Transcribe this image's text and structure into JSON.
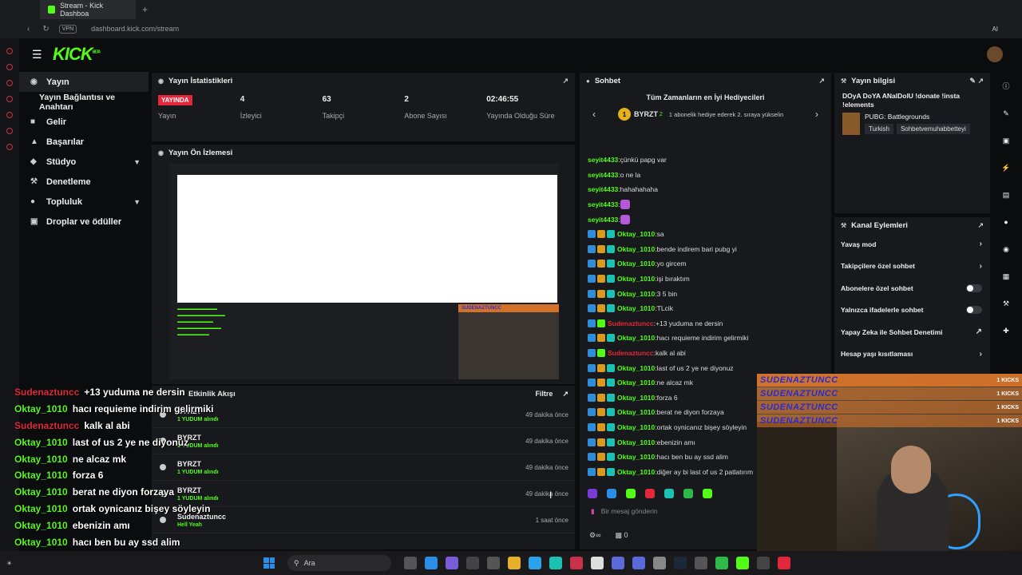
{
  "browser": {
    "tab_title": "Stream - Kick Dashboa",
    "url": "dashboard.kick.com/stream",
    "vpn": "VPN",
    "ai": "AI"
  },
  "app": {
    "logo": "KICK",
    "logo_beta": "BETA"
  },
  "nav": {
    "items": [
      {
        "label": "Yayın",
        "icon": "broadcast-icon"
      },
      {
        "label": "Yayın Bağlantısı ve Anahtarı",
        "icon": ""
      },
      {
        "label": "Gelir",
        "icon": "money-icon"
      },
      {
        "label": "Başarılar",
        "icon": "trophy-icon"
      },
      {
        "label": "Stüdyo",
        "icon": "studio-icon"
      },
      {
        "label": "Denetleme",
        "icon": "wrench-icon"
      },
      {
        "label": "Topluluk",
        "icon": "community-icon"
      },
      {
        "label": "Droplar ve ödüller",
        "icon": "gift-icon"
      }
    ]
  },
  "stats": {
    "title": "Yayın İstatistikleri",
    "items": [
      {
        "value": "YAYINDA",
        "label": "Yayın"
      },
      {
        "value": "4",
        "label": "İzleyici"
      },
      {
        "value": "63",
        "label": "Takipçi"
      },
      {
        "value": "2",
        "label": "Abone Sayısı"
      },
      {
        "value": "02:46:55",
        "label": "Yayında Olduğu Süre"
      }
    ]
  },
  "preview": {
    "title": "Yayın Ön İzlemesi",
    "cam_label": "SUDENAZTUNCC"
  },
  "activity": {
    "title": "Etkinlik Akışı",
    "filter": "Filtre",
    "rows": [
      {
        "user": "BYRZT",
        "action": "1 YUDUM alındı",
        "time": "49 dakika önce"
      },
      {
        "user": "BYRZT",
        "action": "1 YUDUM alındı",
        "time": "49 dakika önce"
      },
      {
        "user": "BYRZT",
        "action": "1 YUDUM alındı",
        "time": "49 dakika önce"
      },
      {
        "user": "BYRZT",
        "action": "1 YUDUM alındı",
        "time": "49 dakika önce"
      },
      {
        "user": "Sudenaztuncc",
        "action": "Hell Yeah",
        "time": "1 saat önce"
      }
    ]
  },
  "chat": {
    "title": "Sohbet",
    "gift_header": "Tüm Zamanların en İyi Hediyecileri",
    "top_gifter": {
      "rank": "1",
      "name": "BYRZT",
      "count": "2"
    },
    "gift_note": "1 abonelik hediye ederek 2. sıraya yükselin",
    "messages": [
      {
        "user": "seyit4433",
        "text": "çünkü papg var",
        "color": "#53fc18",
        "badges": []
      },
      {
        "user": "seyit4433",
        "text": "o ne la",
        "color": "#53fc18",
        "badges": []
      },
      {
        "user": "seyit4433",
        "text": "hahahahaha",
        "color": "#53fc18",
        "badges": []
      },
      {
        "user": "seyit4433",
        "text": "",
        "color": "#53fc18",
        "badges": []
      },
      {
        "user": "seyit4433",
        "text": "",
        "color": "#53fc18",
        "badges": []
      },
      {
        "user": "Oktay_1010",
        "text": "sa",
        "color": "#53fc18",
        "badges": [
          "b-blue",
          "b-gold",
          "b-teal"
        ]
      },
      {
        "user": "Oktay_1010",
        "text": "bende indirem bari pubg yi",
        "color": "#53fc18",
        "badges": [
          "b-blue",
          "b-gold",
          "b-teal"
        ]
      },
      {
        "user": "Oktay_1010",
        "text": "yo gircem",
        "color": "#53fc18",
        "badges": [
          "b-blue",
          "b-gold",
          "b-teal"
        ]
      },
      {
        "user": "Oktay_1010",
        "text": "işi bıraktım",
        "color": "#53fc18",
        "badges": [
          "b-blue",
          "b-gold",
          "b-teal"
        ]
      },
      {
        "user": "Oktay_1010",
        "text": "3 5 bin",
        "color": "#53fc18",
        "badges": [
          "b-blue",
          "b-gold",
          "b-teal"
        ]
      },
      {
        "user": "Oktay_1010",
        "text": "TLcik",
        "color": "#53fc18",
        "badges": [
          "b-blue",
          "b-gold",
          "b-teal"
        ]
      },
      {
        "user": "Sudenaztuncc",
        "text": "+13 yuduma ne dersin",
        "color": "#e3283b",
        "badges": [
          "b-blue",
          "b-green"
        ]
      },
      {
        "user": "Oktay_1010",
        "text": "hacı requieme indirim gelirmiki",
        "color": "#53fc18",
        "badges": [
          "b-blue",
          "b-gold",
          "b-teal"
        ]
      },
      {
        "user": "Sudenaztuncc",
        "text": "kalk al abi",
        "color": "#e3283b",
        "badges": [
          "b-blue",
          "b-green"
        ]
      },
      {
        "user": "Oktay_1010",
        "text": "last of us 2 ye ne diyonuz",
        "color": "#53fc18",
        "badges": [
          "b-blue",
          "b-gold",
          "b-teal"
        ]
      },
      {
        "user": "Oktay_1010",
        "text": "ne alcaz mk",
        "color": "#53fc18",
        "badges": [
          "b-blue",
          "b-gold",
          "b-teal"
        ]
      },
      {
        "user": "Oktay_1010",
        "text": "forza 6",
        "color": "#53fc18",
        "badges": [
          "b-blue",
          "b-gold",
          "b-teal"
        ]
      },
      {
        "user": "Oktay_1010",
        "text": "berat ne diyon forzaya",
        "color": "#53fc18",
        "badges": [
          "b-blue",
          "b-gold",
          "b-teal"
        ]
      },
      {
        "user": "Oktay_1010",
        "text": "ortak oynicanız bişey söyleyin",
        "color": "#53fc18",
        "badges": [
          "b-blue",
          "b-gold",
          "b-teal"
        ]
      },
      {
        "user": "Oktay_1010",
        "text": "ebenizin amı",
        "color": "#53fc18",
        "badges": [
          "b-blue",
          "b-gold",
          "b-teal"
        ]
      },
      {
        "user": "Oktay_1010",
        "text": "hacı ben bu ay ssd alim",
        "color": "#53fc18",
        "badges": [
          "b-blue",
          "b-gold",
          "b-teal"
        ]
      },
      {
        "user": "Oktay_1010",
        "text": "diğer ay bi last of us 2 patlatırım",
        "color": "#53fc18",
        "badges": [
          "b-blue",
          "b-gold",
          "b-teal"
        ]
      }
    ],
    "input_placeholder": "Bir mesaj gönderin",
    "points": "0"
  },
  "stream_info": {
    "title": "Yayın bilgisi",
    "stream_title": "DOyA DoYA ANalDolU !donate !insta !elements",
    "game": "PUBG: Battlegrounds",
    "tags": [
      "Turkish",
      "Sohbetvemuhabbetteyi"
    ]
  },
  "channel_actions": {
    "title": "Kanal Eylemleri",
    "items": [
      {
        "label": "Yavaş mod",
        "control": "chevron"
      },
      {
        "label": "Takipçilere özel sohbet",
        "control": "chevron"
      },
      {
        "label": "Abonelere özel sohbet",
        "control": "toggle"
      },
      {
        "label": "Yalnızca ifadelerle sohbet",
        "control": "toggle"
      },
      {
        "label": "Yapay Zeka ile Sohbet Denetimi",
        "control": "external"
      },
      {
        "label": "Hesap yaşı kısıtlaması",
        "control": "chevron"
      }
    ]
  },
  "webcam_alerts": [
    {
      "name": "SUDENAZTUNCC",
      "kicks": "1 KICKS"
    },
    {
      "name": "SUDENAZTUNCC",
      "kicks": "1 KICKS"
    },
    {
      "name": "SUDENAZTUNCC",
      "kicks": "1 KICKS"
    },
    {
      "name": "SUDENAZTUNCC",
      "kicks": "1 KICKS"
    }
  ],
  "overlay_chat": [
    {
      "user": "Sudenaztuncc",
      "text": "+13 yuduma ne dersin",
      "color": "#e3283b"
    },
    {
      "user": "Oktay_1010",
      "text": "hacı requieme indirim gelirmiki",
      "color": "#53fc18"
    },
    {
      "user": "Sudenaztuncc",
      "text": "kalk al abi",
      "color": "#e3283b"
    },
    {
      "user": "Oktay_1010",
      "text": "last of us 2 ye ne diyonuz",
      "color": "#53fc18"
    },
    {
      "user": "Oktay_1010",
      "text": "ne alcaz mk",
      "color": "#53fc18"
    },
    {
      "user": "Oktay_1010",
      "text": "forza 6",
      "color": "#53fc18"
    },
    {
      "user": "Oktay_1010",
      "text": "berat ne diyon forzaya",
      "color": "#53fc18"
    },
    {
      "user": "Oktay_1010",
      "text": "ortak oynicanız bişey söyleyin",
      "color": "#53fc18"
    },
    {
      "user": "Oktay_1010",
      "text": "ebenizin amı",
      "color": "#53fc18"
    },
    {
      "user": "Oktay_1010",
      "text": "hacı ben bu ay ssd alim",
      "color": "#53fc18"
    },
    {
      "user": "Oktay_1010",
      "text": "diğer ay bi last of us 2 patlatırım",
      "color": "#53fc18"
    }
  ],
  "taskbar": {
    "search": "Ara"
  },
  "colors": {
    "brand": "#53fc18",
    "live": "#e3283b"
  }
}
